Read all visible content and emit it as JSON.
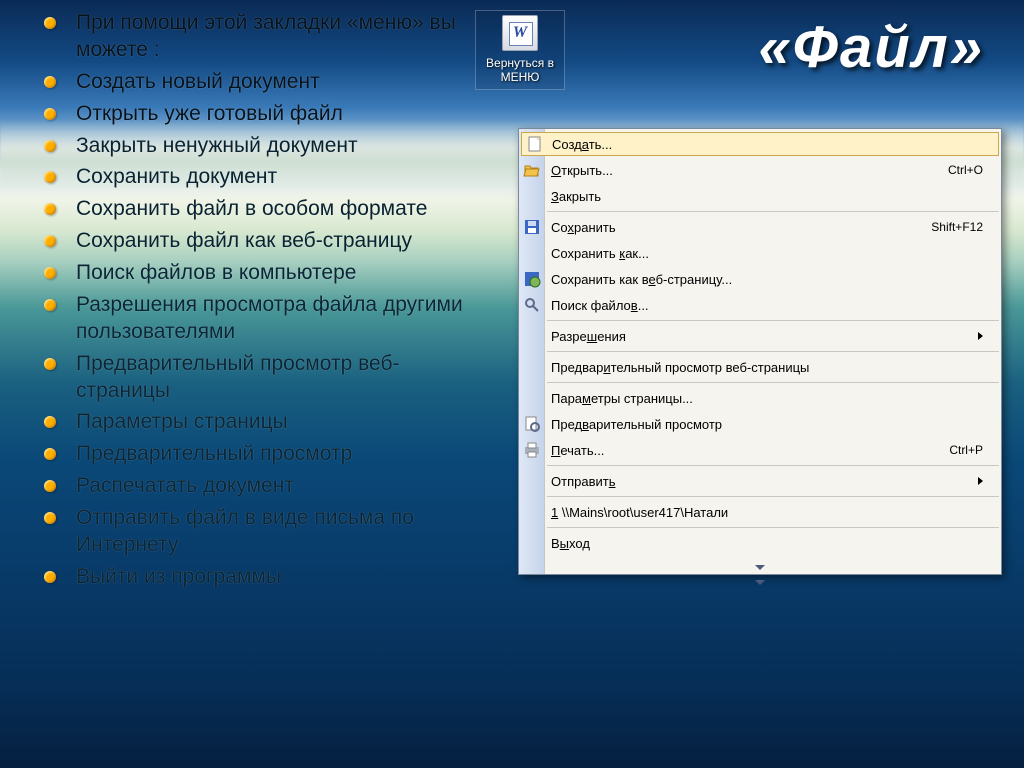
{
  "title": "«Файл»",
  "back_button": {
    "label": "Вернуться в МЕНЮ"
  },
  "bullets": [
    "При помощи этой закладки «меню» вы можете :",
    "Создать новый документ",
    "Открыть уже готовый файл",
    "Закрыть ненужный документ",
    "Сохранить документ",
    "Сохранить файл в особом формате",
    "Сохранить файл как веб-страницу",
    "Поиск файлов в компьютере",
    "Разрешения просмотра файла другими пользователями",
    "Предварительный просмотр веб-страницы",
    "Параметры страницы",
    "Предварительный просмотр",
    "Распечатать документ",
    "Отправить файл в виде письма по Интернету",
    "Выйти из программы"
  ],
  "menu": {
    "items": [
      {
        "label": "Создать...",
        "icon": "new",
        "highlighted": true
      },
      {
        "label": "Открыть...",
        "shortcut": "Ctrl+O",
        "icon": "open"
      },
      {
        "label": "Закрыть"
      },
      {
        "sep": true
      },
      {
        "label": "Сохранить",
        "shortcut": "Shift+F12",
        "icon": "save"
      },
      {
        "label": "Сохранить как..."
      },
      {
        "label": "Сохранить как веб-страницу...",
        "icon": "web"
      },
      {
        "label": "Поиск файлов...",
        "icon": "search"
      },
      {
        "sep": true
      },
      {
        "label": "Разрешения",
        "submenu": true
      },
      {
        "sep": true
      },
      {
        "label": "Предварительный просмотр веб-страницы"
      },
      {
        "sep": true
      },
      {
        "label": "Параметры страницы..."
      },
      {
        "label": "Предварительный просмотр",
        "icon": "preview"
      },
      {
        "label": "Печать...",
        "shortcut": "Ctrl+P",
        "icon": "print"
      },
      {
        "sep": true
      },
      {
        "label": "Отправить",
        "submenu": true
      },
      {
        "sep": true
      },
      {
        "label": "1 \\\\Mains\\root\\user417\\Натали"
      },
      {
        "sep": true
      },
      {
        "label": "Выход"
      }
    ]
  }
}
